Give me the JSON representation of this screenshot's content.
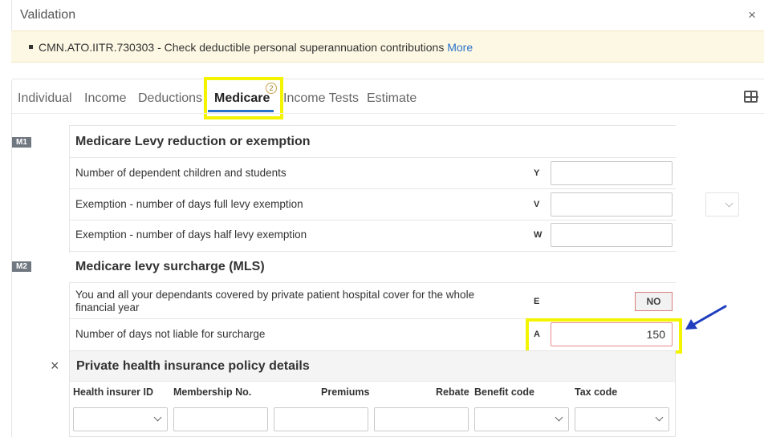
{
  "validation": {
    "title": "Validation",
    "close": "×",
    "message_code": "CMN.ATO.IITR.730303 - Check deductible personal superannuation contributions",
    "more_link": "More"
  },
  "tabs": [
    {
      "label": "Individual"
    },
    {
      "label": "Income"
    },
    {
      "label": "Deductions"
    },
    {
      "label": "Medicare",
      "active": true,
      "badge": "2"
    },
    {
      "label": "Income Tests"
    },
    {
      "label": "Estimate"
    }
  ],
  "m1": {
    "tag": "M1",
    "title": "Medicare Levy reduction or exemption",
    "rows": [
      {
        "label": "Number of dependent children and students",
        "code": "Y",
        "value": ""
      },
      {
        "label": "Exemption - number of days full levy exemption",
        "code": "V",
        "value": ""
      },
      {
        "label": "Exemption - number of days half levy exemption",
        "code": "W",
        "value": ""
      }
    ]
  },
  "m2": {
    "tag": "M2",
    "title": "Medicare levy surcharge (MLS)",
    "rows": [
      {
        "label": "You and all your dependants covered by private patient hospital cover for the whole financial year",
        "code": "E",
        "value": "NO"
      },
      {
        "label": "Number of days not liable for surcharge",
        "code": "A",
        "value": "150"
      }
    ]
  },
  "phi": {
    "close": "×",
    "title": "Private health insurance policy details",
    "columns": [
      "Health insurer ID",
      "Membership No.",
      "Premiums",
      "Rebate",
      "Benefit code",
      "Tax code"
    ]
  },
  "colors": {
    "accent": "#2a72c9",
    "highlight": "#f4f400",
    "arrow": "#1f3fbf",
    "error_border": "#e58a8a"
  }
}
